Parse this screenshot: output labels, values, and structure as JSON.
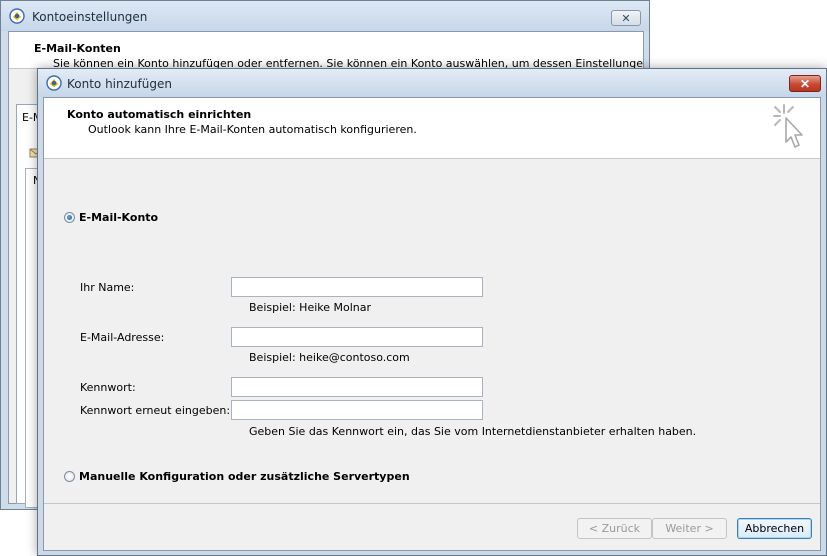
{
  "background_window": {
    "title": "Kontoeinstellungen",
    "close_label": "✕",
    "header_title": "E-Mail-Konten",
    "header_desc": "Sie können ein Konto hinzufügen oder entfernen. Sie können ein Konto auswählen, um dessen Einstellungen zu",
    "tab_label": "E-M",
    "list_label": "N"
  },
  "dialog": {
    "title": "Konto hinzufügen",
    "close_label": "✕",
    "header_title": "Konto automatisch einrichten",
    "header_desc": "Outlook kann Ihre E-Mail-Konten automatisch konfigurieren.",
    "option_email": "E-Mail-Konto",
    "option_manual": "Manuelle Konfiguration oder zusätzliche Servertypen",
    "selected_option": "E-Mail-Konto",
    "fields": {
      "name_label": "Ihr Name:",
      "name_value": "",
      "name_hint": "Beispiel: Heike Molnar",
      "email_label": "E-Mail-Adresse:",
      "email_value": "",
      "email_hint": "Beispiel: heike@contoso.com",
      "password_label": "Kennwort:",
      "password_value": "",
      "password_repeat_label": "Kennwort erneut eingeben:",
      "password_repeat_value": "",
      "password_hint": "Geben Sie das Kennwort ein, das Sie vom Internetdienstanbieter erhalten haben."
    },
    "buttons": {
      "back": "< Zurück",
      "next": "Weiter >",
      "cancel": "Abbrechen"
    }
  },
  "colors": {
    "window_frame": "#cbd9e9",
    "close_red": "#c84a32",
    "default_button_border": "#3c7fb1"
  }
}
